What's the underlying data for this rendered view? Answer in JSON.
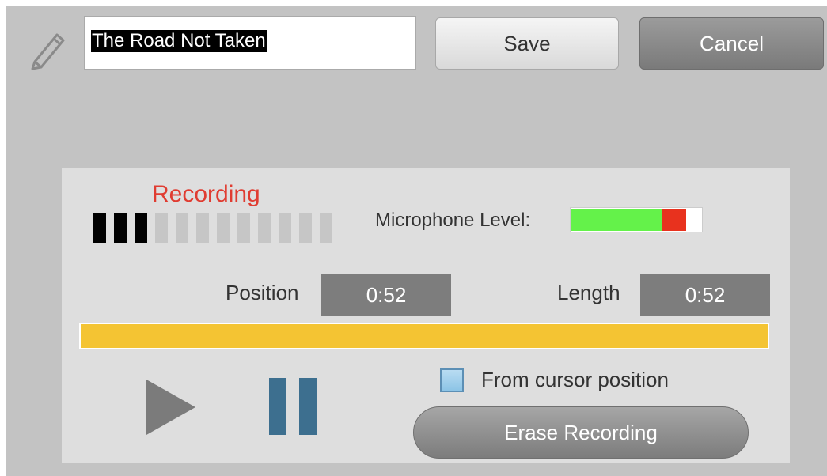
{
  "title_field": {
    "value": "The Road Not Taken"
  },
  "toolbar": {
    "save_label": "Save",
    "cancel_label": "Cancel"
  },
  "recorder": {
    "status": "Recording",
    "status_color": "#e03c31",
    "progress_ticks": {
      "total": 12,
      "filled": 3
    },
    "mic_label": "Microphone Level:",
    "mic_level": {
      "green_fraction": 0.7,
      "red_fraction": 0.18
    },
    "position_label": "Position",
    "position_value": "0:52",
    "length_label": "Length",
    "length_value": "0:52",
    "timeline_fraction": 1.0,
    "from_cursor_label": "From cursor position",
    "from_cursor_checked": false,
    "erase_label": "Erase Recording",
    "icons": [
      "pencil-icon",
      "play-icon",
      "pause-icon"
    ],
    "colors": {
      "timeline": "#f4c433",
      "pause": "#3d6f8f",
      "mic_green": "#64f24a",
      "mic_red": "#e8321e"
    }
  }
}
